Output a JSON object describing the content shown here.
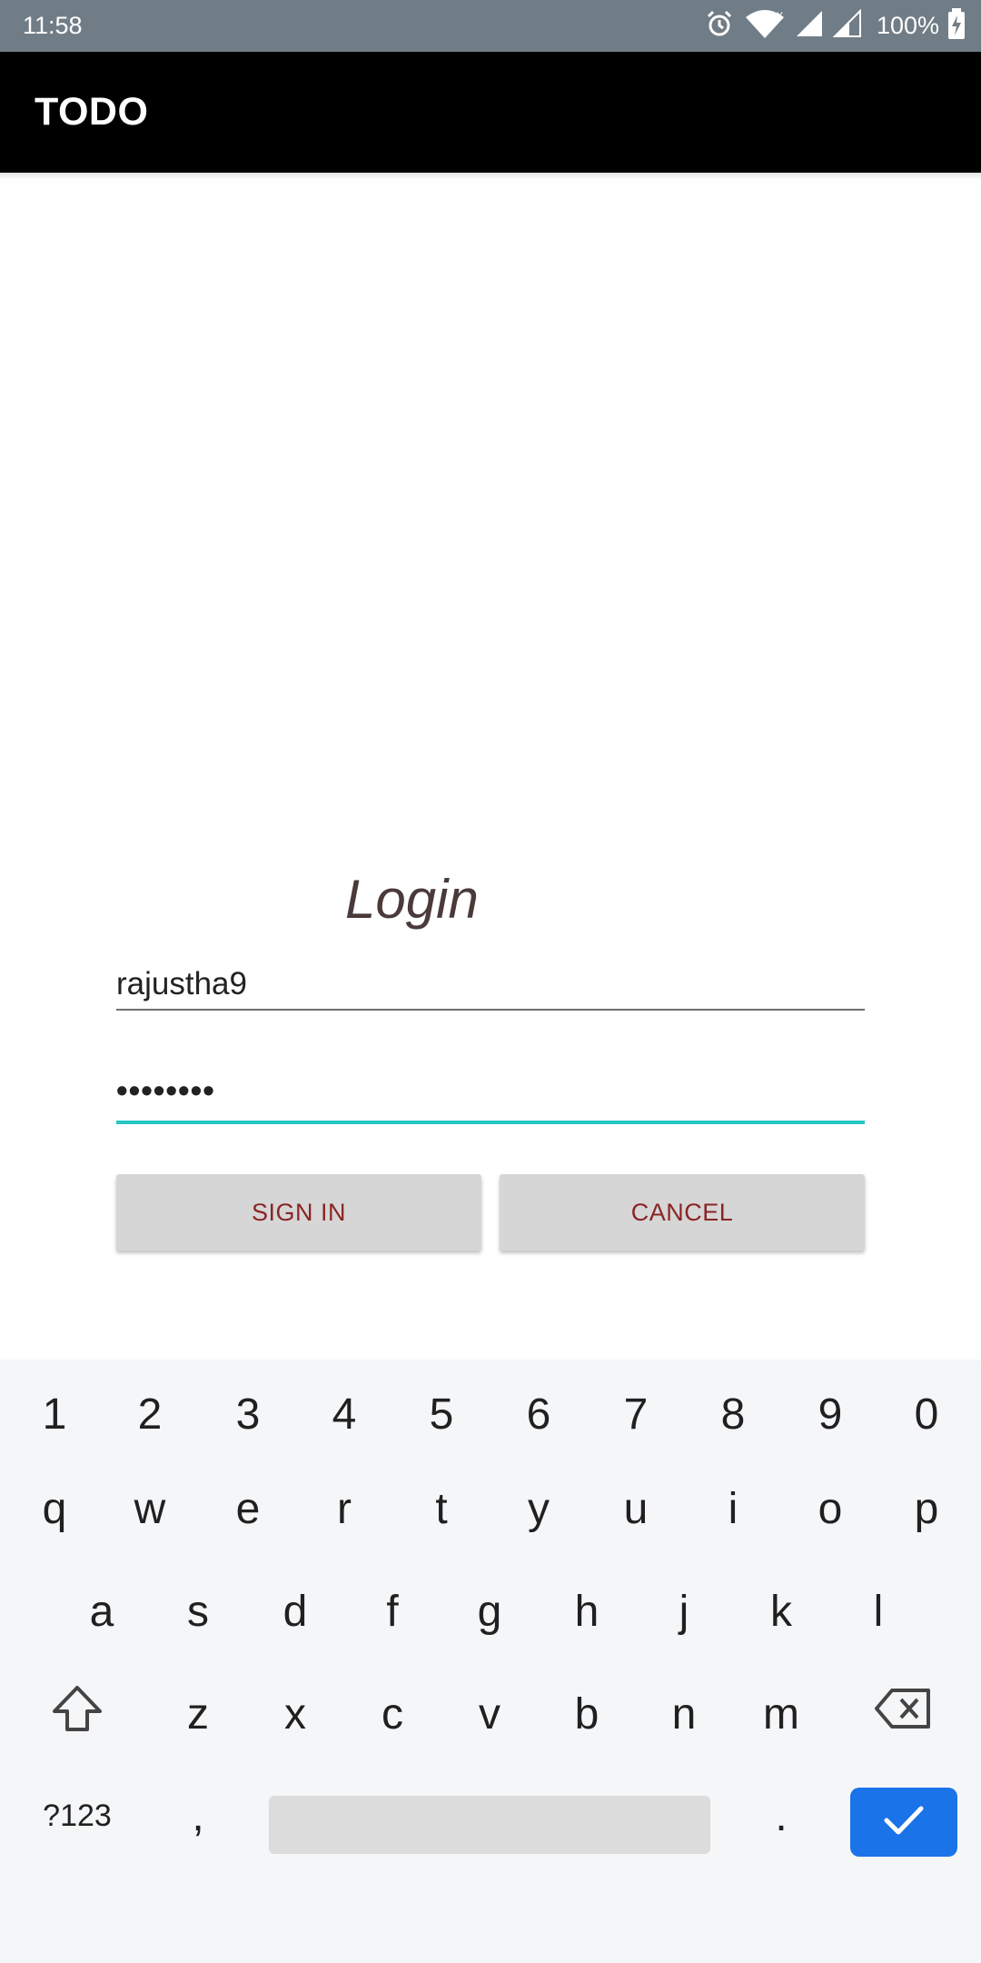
{
  "status_bar": {
    "time": "11:58",
    "battery": "100%",
    "icons": [
      "alarm-icon",
      "wifi-icon",
      "signal-icon",
      "signal-icon",
      "battery-charging-icon"
    ]
  },
  "app_bar": {
    "title": "TODO"
  },
  "login": {
    "title": "Login",
    "username_value": "rajustha9",
    "password_value": "••••••••",
    "sign_in_label": "SIGN IN",
    "cancel_label": "CANCEL",
    "accent_color": "#26c6c3",
    "button_text_color": "#8b2525"
  },
  "keyboard": {
    "number_row": [
      "1",
      "2",
      "3",
      "4",
      "5",
      "6",
      "7",
      "8",
      "9",
      "0"
    ],
    "row1": [
      "q",
      "w",
      "e",
      "r",
      "t",
      "y",
      "u",
      "i",
      "o",
      "p"
    ],
    "row2": [
      "a",
      "s",
      "d",
      "f",
      "g",
      "h",
      "j",
      "k",
      "l"
    ],
    "row3": [
      "z",
      "x",
      "c",
      "v",
      "b",
      "n",
      "m"
    ],
    "symbols_label": "?123",
    "comma_label": ",",
    "period_label": ".",
    "enter_color": "#1a73e8"
  }
}
